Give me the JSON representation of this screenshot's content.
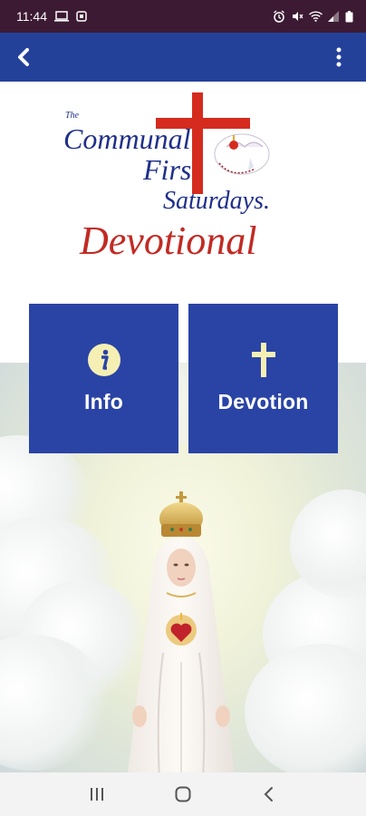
{
  "status_bar": {
    "time": "11:44",
    "left_icons": [
      "laptop-icon",
      "app-notification-icon"
    ],
    "right_icons": [
      "alarm-icon",
      "mute-icon",
      "wifi-icon",
      "signal-icon",
      "battery-icon"
    ]
  },
  "app_bar": {
    "back_icon": "chevron-left-icon",
    "menu_icon": "more-vertical-icon",
    "color": "#24419a"
  },
  "logo": {
    "small": "The",
    "line1": "Communal",
    "line2": "Firs",
    "line3": "Saturdays.",
    "line4": "Devotional"
  },
  "tiles": [
    {
      "label": "Info",
      "icon": "info-icon"
    },
    {
      "label": "Devotion",
      "icon": "cross-icon"
    }
  ],
  "colors": {
    "tile": "#2a44a6",
    "cross_red": "#d52b1e",
    "logo_blue": "#1f2f8a",
    "icon_yellow": "#f6efb4"
  },
  "nav_bar": {
    "icons": [
      "recent-apps-icon",
      "home-icon",
      "back-icon"
    ]
  }
}
